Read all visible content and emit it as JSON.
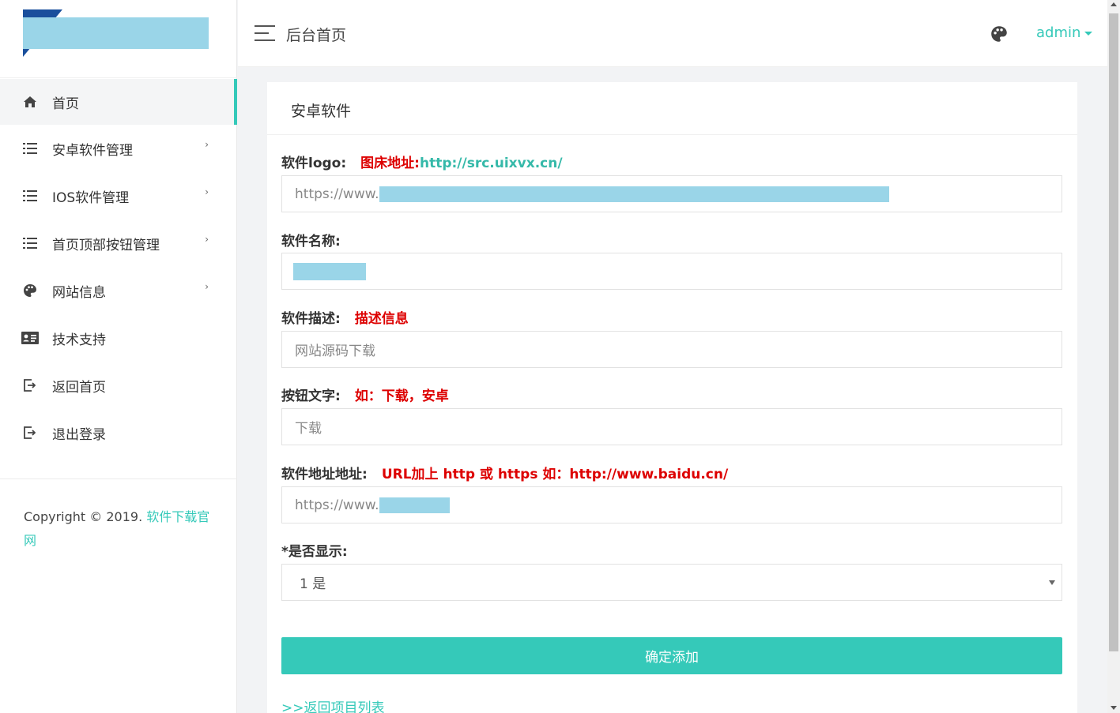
{
  "sidebar": {
    "items": [
      {
        "label": "首页",
        "icon": "home-icon"
      },
      {
        "label": "安卓软件管理",
        "icon": "list-icon",
        "chevron": "›"
      },
      {
        "label": "IOS软件管理",
        "icon": "list-icon",
        "chevron": "›"
      },
      {
        "label": "首页顶部按钮管理",
        "icon": "list-icon",
        "chevron": "›"
      },
      {
        "label": "网站信息",
        "icon": "palette-icon",
        "chevron": "›"
      },
      {
        "label": "技术支持",
        "icon": "id-card-icon"
      },
      {
        "label": "返回首页",
        "icon": "sign-out-icon"
      },
      {
        "label": "退出登录",
        "icon": "sign-out-icon"
      }
    ],
    "copyright_prefix": "Copyright © 2019.",
    "copyright_link": "软件下载官网"
  },
  "header": {
    "title": "后台首页",
    "user": "admin"
  },
  "card": {
    "title": "安卓软件",
    "fields": {
      "logo": {
        "label": "软件logo:",
        "hint": "图床地址:",
        "hint_link": "http://src.uixvx.cn/",
        "value": "https://www."
      },
      "name": {
        "label": "软件名称:",
        "value": ""
      },
      "desc": {
        "label": "软件描述:",
        "hint": "描述信息",
        "placeholder": "网站源码下载"
      },
      "button_text": {
        "label": "按钮文字:",
        "hint": "如：下载，安卓",
        "placeholder": "下载"
      },
      "url": {
        "label": "软件地址地址:",
        "hint": "URL加上 http 或 https 如：http://www.baidu.cn/",
        "value": "https://www."
      },
      "display": {
        "label": "*是否显示:",
        "selected": "1 是"
      }
    },
    "submit": "确定添加",
    "back_link": ">>返回项目列表"
  },
  "colors": {
    "accent": "#35c9b9",
    "hint_red": "#dd0000",
    "redaction": "#9ad5e8"
  }
}
